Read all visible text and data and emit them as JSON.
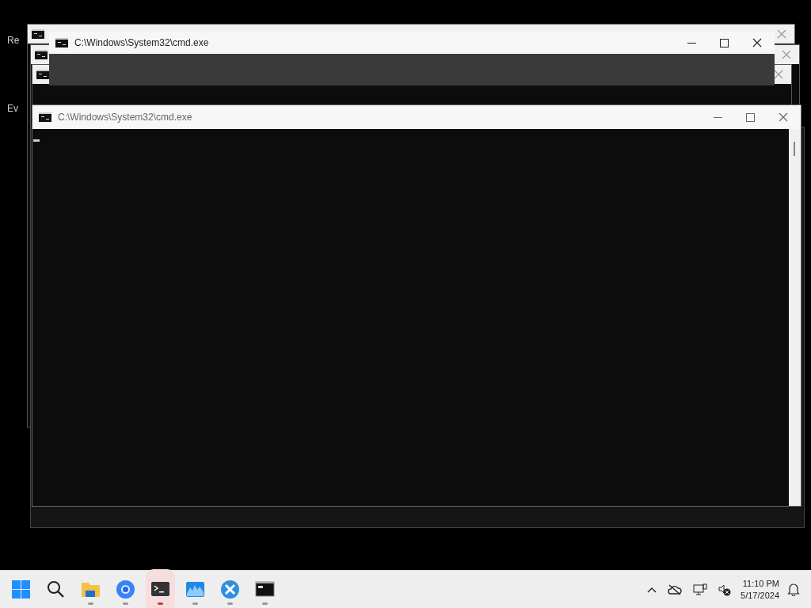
{
  "desktop_icons": [
    {
      "label": "Re"
    },
    {
      "label": "Ev"
    }
  ],
  "windows": [
    {
      "kind": "frame"
    },
    {
      "kind": "frame"
    },
    {
      "kind": "frame"
    },
    {
      "kind": "faded",
      "title": "C:\\Windows\\System32\\cmd.exe"
    },
    {
      "kind": "console",
      "title": "C:\\Windows\\System32\\cmd.exe"
    }
  ],
  "taskbar": {
    "apps": [
      {
        "kind": "start"
      },
      {
        "kind": "search"
      },
      {
        "kind": "folder",
        "active": false
      },
      {
        "kind": "browser",
        "active": false
      },
      {
        "kind": "terminal",
        "active": true
      },
      {
        "kind": "monitor",
        "active": false
      },
      {
        "kind": "tool",
        "active": false
      },
      {
        "kind": "cmd",
        "active": false
      }
    ],
    "time": "11:10 PM",
    "date": "5/17/2024"
  }
}
